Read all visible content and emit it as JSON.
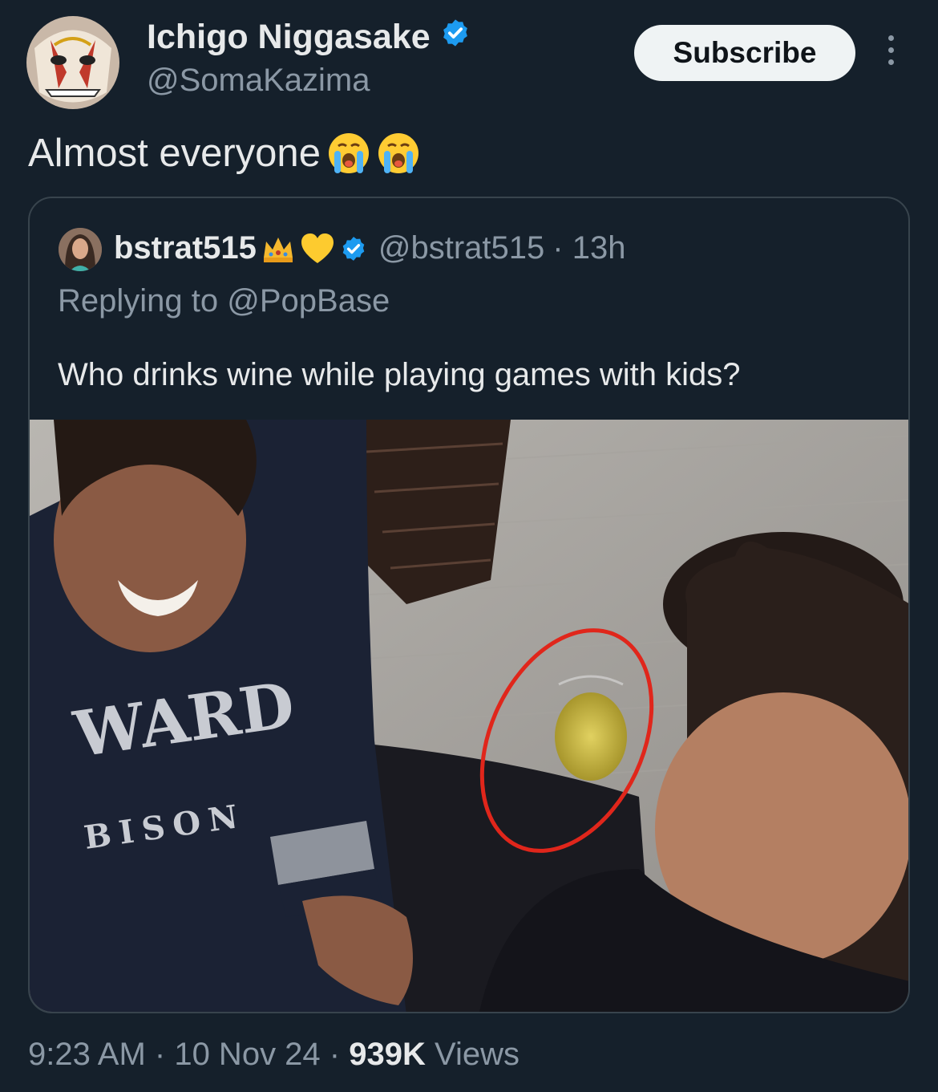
{
  "author": {
    "name": "Ichigo Niggasake",
    "handle": "@SomaKazima",
    "verified": true
  },
  "subscribe_label": "Subscribe",
  "tweet": {
    "text": "Almost everyone",
    "emojis": [
      "loudly-crying-face",
      "loudly-crying-face"
    ]
  },
  "quote": {
    "name": "bstrat515",
    "name_emojis": [
      "crown",
      "yellow-heart"
    ],
    "handle": "@bstrat515",
    "time": "· 13h",
    "replying_prefix": "Replying to",
    "replying_to": "@PopBase",
    "text": "Who drinks wine while playing games with kids?",
    "photo": {
      "sweatshirt_text_1": "WARD",
      "sweatshirt_text_2": "BISON",
      "annotation": "red circle around glass"
    }
  },
  "meta": {
    "time": "9:23 AM",
    "date": "10 Nov 24",
    "views_count": "939K",
    "views_label": "Views"
  },
  "colors": {
    "background": "#15202b",
    "verified_blue": "#1d9bf0",
    "secondary_text": "#8b98a5",
    "annotation_red": "#e0261b"
  }
}
